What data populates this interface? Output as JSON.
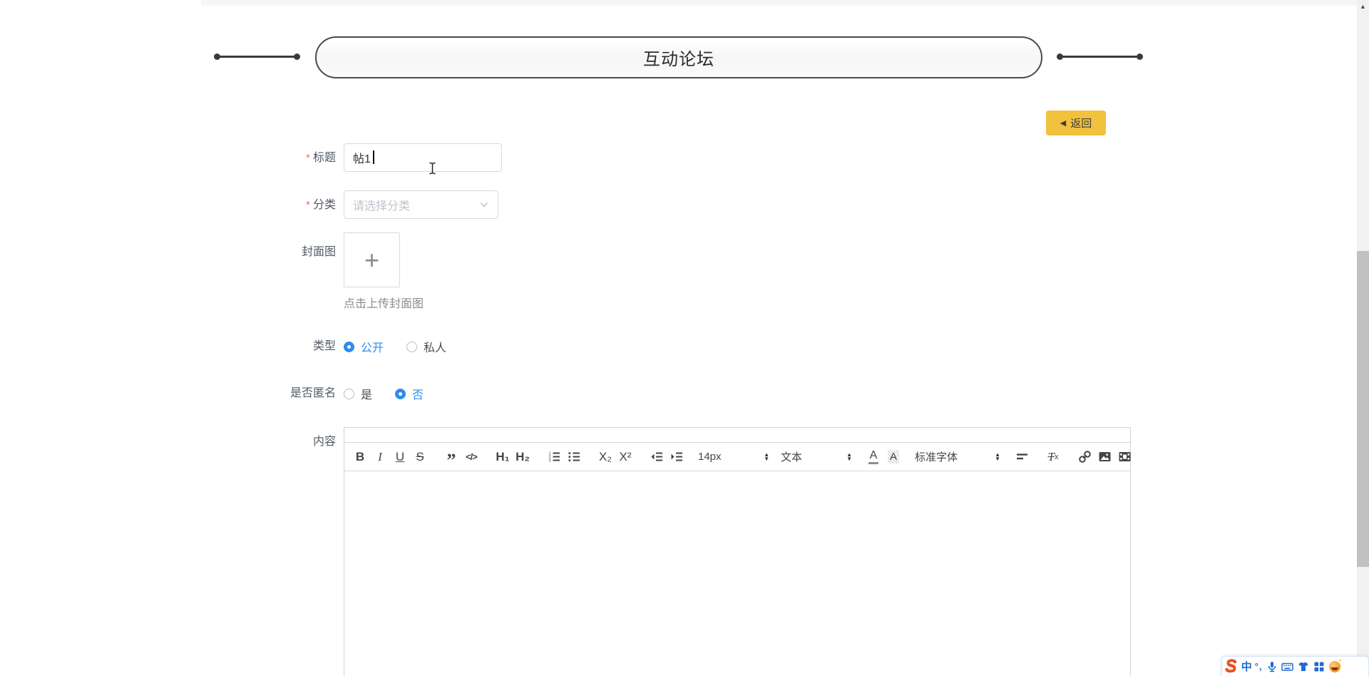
{
  "page": {
    "title": "互动论坛",
    "back_arrow": "◀",
    "back_label": "返回",
    "required_marker": "*"
  },
  "form": {
    "title": {
      "label": "标题",
      "value": "帖1"
    },
    "category": {
      "label": "分类",
      "placeholder": "请选择分类"
    },
    "cover": {
      "label": "封面图",
      "plus": "+",
      "hint": "点击上传封面图"
    },
    "type": {
      "label": "类型",
      "option_public": "公开",
      "option_private": "私人",
      "selected": "公开"
    },
    "anonymous": {
      "label": "是否匿名",
      "option_yes": "是",
      "option_no": "否",
      "selected": "否"
    },
    "content": {
      "label": "内容"
    }
  },
  "editor": {
    "glyphs": {
      "bold": "B",
      "italic": "I",
      "underline": "U",
      "strike": "S",
      "quote": "”",
      "code": "</>",
      "h1": "H₁",
      "h2": "H₂",
      "subscript": "X₂",
      "superscript": "X²",
      "color": "A",
      "bgcolor": "A",
      "clear_t": "T",
      "clear_x": "x",
      "updown_up": "▲",
      "updown_down": "▼"
    },
    "dropdowns": {
      "font_size": "14px",
      "format": "文本",
      "font_family": "标准字体"
    }
  },
  "scrollbar": {
    "up_arrow": "▲"
  },
  "ime": {
    "logo": "S",
    "mode": "中",
    "punct": "°,"
  },
  "colors": {
    "accent_blue": "#2d8cf0",
    "button_yellow": "#f2c13d",
    "required_red": "#f56c6c",
    "icon_gray": "#454545",
    "ime_blue": "#1e6bd6",
    "scroll_thumb": "#c1c1c1"
  }
}
